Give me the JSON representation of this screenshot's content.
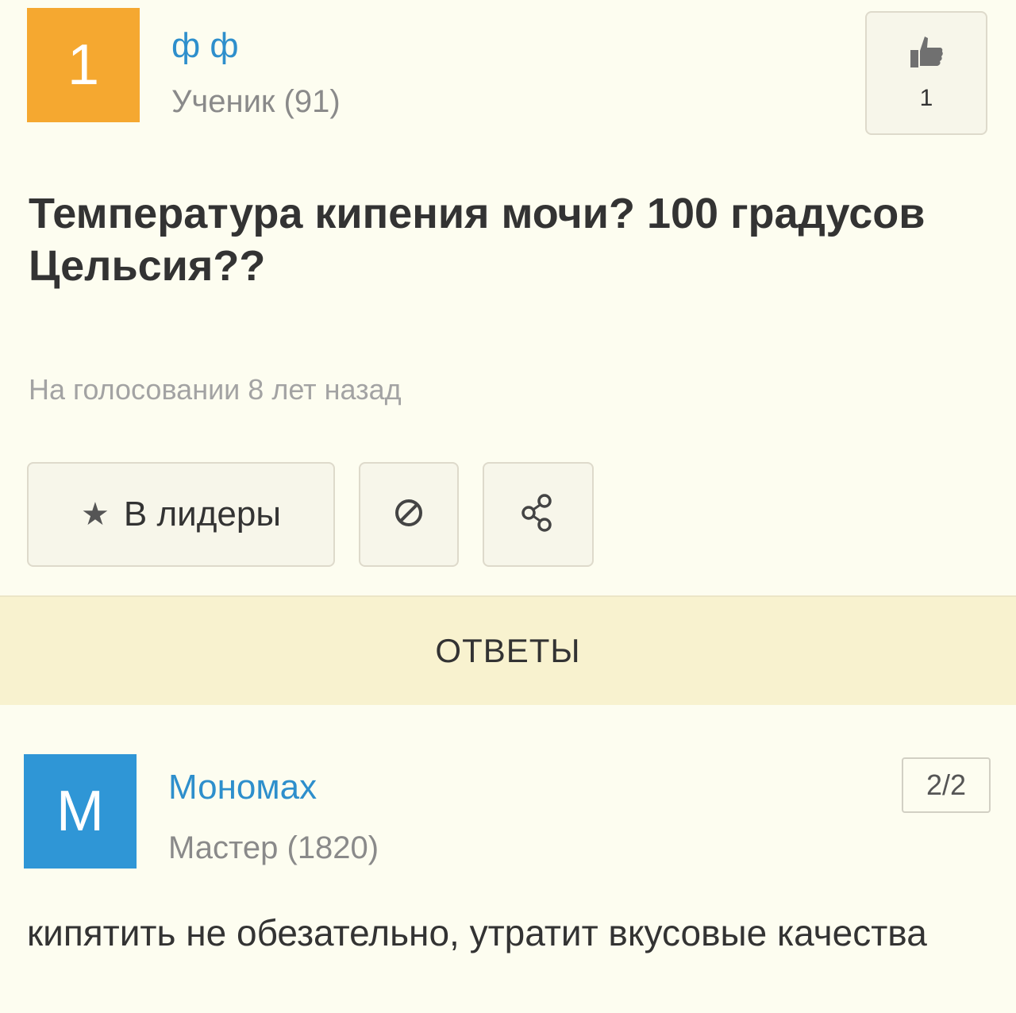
{
  "question": {
    "author": {
      "avatar_letter": "1",
      "avatar_color": "#f5a830",
      "name": "ф ф",
      "rank": "Ученик (91)"
    },
    "like_count": "1",
    "title": "Температура кипения мочи? 100 градусов Цельсия??",
    "meta": "На голосовании 8 лет назад",
    "actions": {
      "leaders_label": "В лидеры",
      "leaders_icon": "star-icon",
      "report_icon": "block-icon",
      "share_icon": "share-icon"
    }
  },
  "answers_header": "ОТВЕТЫ",
  "answer": {
    "author": {
      "avatar_letter": "М",
      "avatar_color": "#2f96d6",
      "name": "Мономах",
      "rank": "Мастер (1820)"
    },
    "page": "2/2",
    "text": "кипятить не обезательно, утратит вкусовые качества"
  },
  "colors": {
    "background": "#fdfdf0",
    "link": "#2e8fcc",
    "band": "#f8f2cf"
  }
}
